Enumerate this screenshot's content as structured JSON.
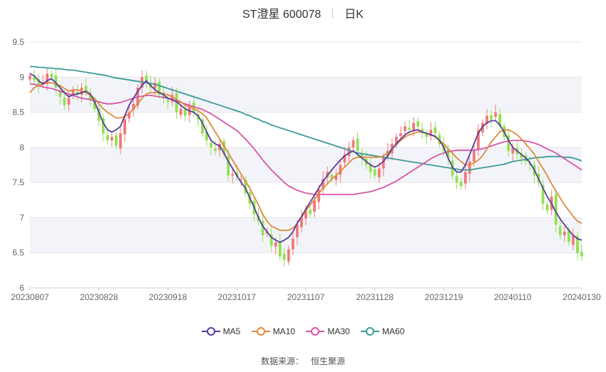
{
  "chart_data": {
    "type": "candlestick",
    "title": "ST澄星 600078",
    "period_label": "日K",
    "x_tick_labels": [
      "20230807",
      "20230828",
      "20230918",
      "20231017",
      "20231107",
      "20231128",
      "20231219",
      "20240110",
      "20240130"
    ],
    "y_tick_labels": [
      "6",
      "6.5",
      "7",
      "7.5",
      "8",
      "8.5",
      "9",
      "9.5"
    ],
    "ylim": [
      6,
      9.5
    ],
    "y_ticks": [
      6,
      6.5,
      7,
      7.5,
      8,
      8.5,
      9,
      9.5
    ],
    "legend": [
      {
        "name": "MA5",
        "color": "#5b3e9b"
      },
      {
        "name": "MA10",
        "color": "#e08a3c"
      },
      {
        "name": "MA30",
        "color": "#d855a8"
      },
      {
        "name": "MA60",
        "color": "#3a9a98"
      }
    ],
    "colors": {
      "up": "#f07878",
      "down": "#92e050",
      "band": "#f3f4f9",
      "grid": "#e6e6e6"
    },
    "close": [
      9.02,
      8.96,
      8.88,
      8.93,
      9.05,
      9.0,
      8.85,
      8.72,
      8.6,
      8.7,
      8.82,
      8.75,
      8.85,
      8.8,
      8.68,
      8.55,
      8.38,
      8.2,
      8.1,
      8.15,
      8.02,
      8.2,
      8.4,
      8.5,
      8.62,
      8.85,
      9.0,
      8.95,
      8.85,
      8.92,
      8.75,
      8.7,
      8.65,
      8.75,
      8.5,
      8.55,
      8.45,
      8.6,
      8.5,
      8.4,
      8.2,
      8.1,
      8.0,
      7.95,
      8.05,
      7.9,
      7.6,
      7.62,
      7.58,
      7.55,
      7.35,
      7.2,
      7.05,
      6.95,
      6.75,
      6.8,
      6.6,
      6.65,
      6.45,
      6.4,
      6.55,
      6.7,
      6.9,
      7.0,
      7.1,
      7.05,
      7.25,
      7.4,
      7.55,
      7.65,
      7.55,
      7.6,
      7.75,
      7.9,
      8.0,
      8.1,
      7.95,
      7.85,
      7.75,
      7.65,
      7.6,
      7.7,
      7.85,
      7.95,
      8.05,
      8.15,
      8.2,
      8.3,
      8.25,
      8.35,
      8.3,
      8.2,
      8.15,
      8.25,
      8.2,
      8.05,
      7.95,
      7.85,
      7.6,
      7.5,
      7.45,
      7.65,
      7.8,
      7.95,
      8.25,
      8.35,
      8.45,
      8.4,
      8.5,
      8.3,
      8.15,
      7.95,
      8.0,
      7.9,
      7.85,
      7.8,
      7.75,
      7.6,
      7.5,
      7.2,
      7.1,
      7.3,
      6.9,
      6.75,
      6.8,
      6.65,
      6.75,
      6.5,
      6.45
    ],
    "ma5": [
      9.05,
      9.02,
      8.95,
      8.9,
      8.95,
      8.98,
      8.92,
      8.85,
      8.78,
      8.72,
      8.75,
      8.76,
      8.78,
      8.8,
      8.76,
      8.65,
      8.5,
      8.35,
      8.25,
      8.22,
      8.25,
      8.3,
      8.45,
      8.6,
      8.7,
      8.8,
      8.88,
      8.95,
      8.88,
      8.82,
      8.78,
      8.75,
      8.7,
      8.68,
      8.65,
      8.6,
      8.55,
      8.52,
      8.5,
      8.45,
      8.35,
      8.22,
      8.1,
      8.05,
      8.02,
      7.92,
      7.8,
      7.7,
      7.6,
      7.5,
      7.42,
      7.28,
      7.15,
      7.0,
      6.88,
      6.8,
      6.72,
      6.68,
      6.65,
      6.68,
      6.72,
      6.8,
      6.92,
      7.02,
      7.12,
      7.22,
      7.32,
      7.42,
      7.52,
      7.6,
      7.68,
      7.75,
      7.82,
      7.88,
      7.92,
      7.95,
      7.9,
      7.85,
      7.8,
      7.75,
      7.72,
      7.75,
      7.8,
      7.88,
      7.98,
      8.05,
      8.12,
      8.18,
      8.22,
      8.24,
      8.25,
      8.22,
      8.2,
      8.18,
      8.16,
      8.1,
      8.0,
      7.85,
      7.72,
      7.65,
      7.65,
      7.75,
      7.9,
      8.05,
      8.2,
      8.3,
      8.35,
      8.38,
      8.38,
      8.32,
      8.22,
      8.1,
      8.0,
      7.95,
      7.9,
      7.85,
      7.78,
      7.68,
      7.55,
      7.42,
      7.3,
      7.2,
      7.08,
      6.98,
      6.9,
      6.82,
      6.75,
      6.7,
      6.68
    ],
    "ma10": [
      8.78,
      8.85,
      8.88,
      8.9,
      8.92,
      8.92,
      8.9,
      8.88,
      8.84,
      8.8,
      8.82,
      8.82,
      8.8,
      8.78,
      8.74,
      8.7,
      8.62,
      8.55,
      8.5,
      8.46,
      8.42,
      8.42,
      8.44,
      8.48,
      8.55,
      8.62,
      8.7,
      8.76,
      8.78,
      8.78,
      8.78,
      8.76,
      8.75,
      8.72,
      8.68,
      8.65,
      8.6,
      8.58,
      8.55,
      8.52,
      8.48,
      8.42,
      8.32,
      8.22,
      8.12,
      8.02,
      7.92,
      7.82,
      7.72,
      7.62,
      7.52,
      7.42,
      7.3,
      7.18,
      7.05,
      6.95,
      6.88,
      6.85,
      6.82,
      6.82,
      6.82,
      6.85,
      6.92,
      7.0,
      7.1,
      7.18,
      7.26,
      7.34,
      7.42,
      7.48,
      7.55,
      7.6,
      7.66,
      7.72,
      7.78,
      7.84,
      7.86,
      7.86,
      7.86,
      7.86,
      7.86,
      7.86,
      7.88,
      7.92,
      7.98,
      8.04,
      8.1,
      8.15,
      8.18,
      8.2,
      8.22,
      8.22,
      8.2,
      8.18,
      8.15,
      8.1,
      8.05,
      7.98,
      7.92,
      7.85,
      7.8,
      7.75,
      7.75,
      7.78,
      7.82,
      7.88,
      7.98,
      8.08,
      8.15,
      8.22,
      8.25,
      8.25,
      8.22,
      8.18,
      8.12,
      8.05,
      7.98,
      7.9,
      7.8,
      7.7,
      7.6,
      7.48,
      7.38,
      7.28,
      7.18,
      7.1,
      7.02,
      6.95,
      6.92
    ],
    "ma30": [
      8.9,
      8.9,
      8.88,
      8.86,
      8.85,
      8.84,
      8.82,
      8.8,
      8.78,
      8.76,
      8.74,
      8.72,
      8.7,
      8.69,
      8.68,
      8.66,
      8.65,
      8.63,
      8.62,
      8.62,
      8.63,
      8.64,
      8.66,
      8.68,
      8.7,
      8.72,
      8.73,
      8.74,
      8.74,
      8.73,
      8.72,
      8.71,
      8.7,
      8.68,
      8.66,
      8.64,
      8.62,
      8.6,
      8.58,
      8.56,
      8.54,
      8.51,
      8.48,
      8.44,
      8.4,
      8.36,
      8.32,
      8.28,
      8.24,
      8.18,
      8.12,
      8.05,
      7.98,
      7.9,
      7.82,
      7.75,
      7.68,
      7.62,
      7.56,
      7.5,
      7.45,
      7.42,
      7.39,
      7.37,
      7.35,
      7.34,
      7.33,
      7.33,
      7.33,
      7.33,
      7.33,
      7.33,
      7.33,
      7.33,
      7.33,
      7.33,
      7.34,
      7.35,
      7.36,
      7.37,
      7.39,
      7.41,
      7.43,
      7.46,
      7.49,
      7.52,
      7.56,
      7.6,
      7.64,
      7.68,
      7.72,
      7.76,
      7.8,
      7.84,
      7.87,
      7.9,
      7.92,
      7.94,
      7.95,
      7.96,
      7.96,
      7.96,
      7.96,
      7.96,
      7.97,
      7.98,
      8.0,
      8.02,
      8.04,
      8.06,
      8.08,
      8.09,
      8.1,
      8.1,
      8.1,
      8.09,
      8.08,
      8.06,
      8.04,
      8.01,
      7.98,
      7.95,
      7.92,
      7.88,
      7.84,
      7.8,
      7.76,
      7.72,
      7.68
    ],
    "ma60": [
      9.15,
      9.15,
      9.14,
      9.14,
      9.13,
      9.13,
      9.12,
      9.12,
      9.11,
      9.1,
      9.1,
      9.09,
      9.08,
      9.07,
      9.06,
      9.05,
      9.04,
      9.03,
      9.02,
      9.0,
      8.99,
      8.98,
      8.97,
      8.96,
      8.95,
      8.94,
      8.93,
      8.92,
      8.91,
      8.9,
      8.88,
      8.86,
      8.84,
      8.82,
      8.8,
      8.78,
      8.76,
      8.74,
      8.72,
      8.7,
      8.68,
      8.66,
      8.64,
      8.62,
      8.6,
      8.58,
      8.56,
      8.54,
      8.52,
      8.5,
      8.47,
      8.45,
      8.42,
      8.4,
      8.37,
      8.35,
      8.32,
      8.3,
      8.28,
      8.26,
      8.24,
      8.22,
      8.2,
      8.18,
      8.16,
      8.14,
      8.12,
      8.1,
      8.08,
      8.06,
      8.04,
      8.02,
      8.0,
      7.98,
      7.96,
      7.94,
      7.92,
      7.91,
      7.9,
      7.89,
      7.88,
      7.87,
      7.86,
      7.85,
      7.84,
      7.83,
      7.82,
      7.81,
      7.8,
      7.79,
      7.78,
      7.77,
      7.76,
      7.75,
      7.74,
      7.73,
      7.72,
      7.71,
      7.7,
      7.69,
      7.68,
      7.68,
      7.68,
      7.69,
      7.7,
      7.71,
      7.72,
      7.73,
      7.74,
      7.75,
      7.76,
      7.78,
      7.8,
      7.81,
      7.82,
      7.83,
      7.84,
      7.85,
      7.86,
      7.86,
      7.87,
      7.87,
      7.87,
      7.87,
      7.86,
      7.86,
      7.85,
      7.83,
      7.81
    ]
  },
  "source_label": "数据来源：",
  "source_value": "恒生聚源"
}
